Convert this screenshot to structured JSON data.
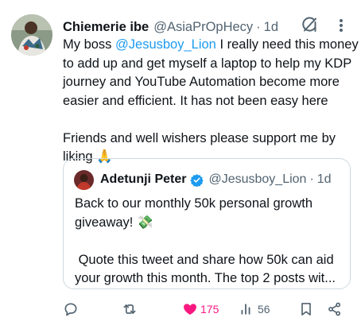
{
  "author": {
    "name": "Chiemerie ibe",
    "handle": "@AsiaPrOpHecy",
    "separator": "·",
    "time": "1d"
  },
  "body": {
    "prefix": "My boss ",
    "mention": "@Jesusboy_Lion",
    "suffix": " I really need this money to add up and get myself a laptop to help my KDP journey and YouTube Automation become more easier and efficient. It has not been easy here\n\nFriends and well wishers please support me by liking 🙏"
  },
  "quote": {
    "name": "Adetunji Peter",
    "handle": "@Jesusboy_Lion",
    "separator": "·",
    "time": "1d",
    "text": "Back to our monthly 50k personal growth giveaway! 💸\n\n Quote this tweet and share how 50k can aid your growth this month. The top 2 posts wit..."
  },
  "actions": {
    "reply_count": "",
    "repost_count": "",
    "like_count": "175",
    "views_count": "56"
  },
  "colors": {
    "accent": "#1d9bf0",
    "like": "#f91880",
    "muted": "#536471",
    "border": "#cfd9de"
  },
  "icons": [
    "grok-icon",
    "more-icon",
    "verified-badge-icon",
    "reply-icon",
    "repost-icon",
    "like-icon",
    "views-icon",
    "bookmark-icon",
    "share-icon"
  ]
}
